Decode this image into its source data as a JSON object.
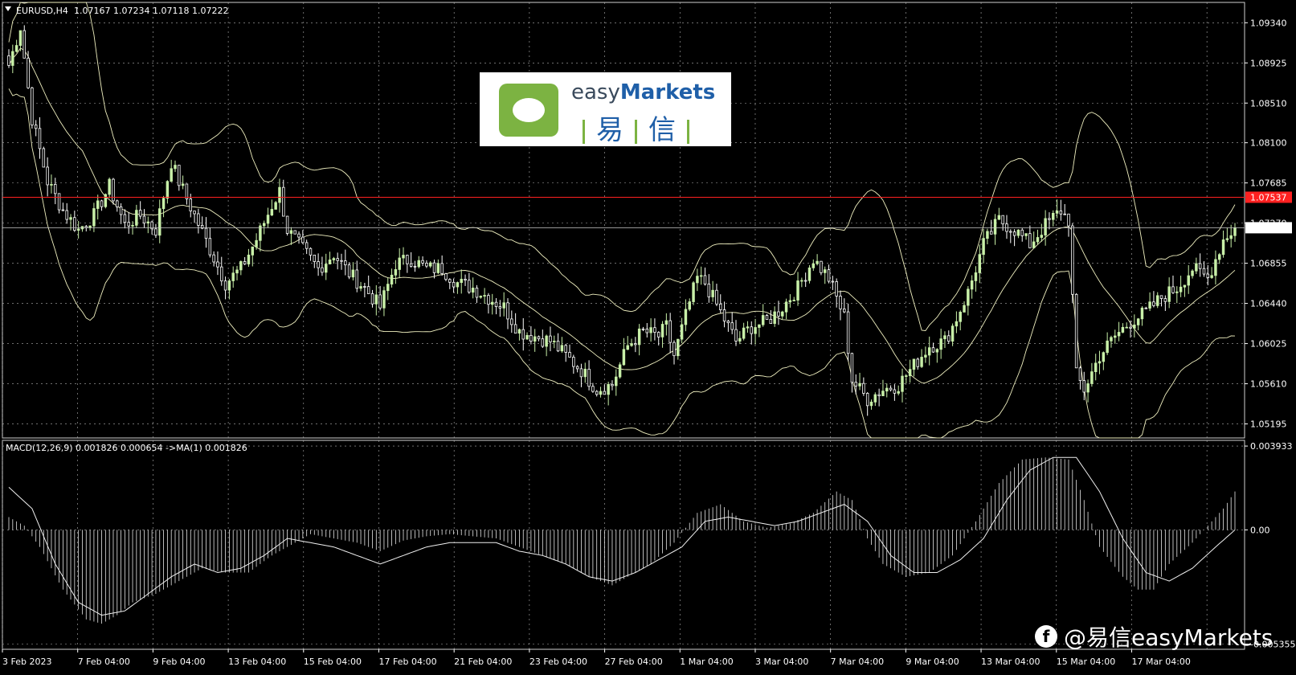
{
  "chart_data": [
    {
      "type": "candlestick",
      "symbol_label": "EURUSD,H4",
      "ohlc_label": "1.07167 1.07234 1.07118 1.07222",
      "y_ticks": [
        "1.09340",
        "1.08925",
        "1.08510",
        "1.08100",
        "1.07685",
        "1.07270",
        "1.06855",
        "1.06440",
        "1.06025",
        "1.05610",
        "1.05195"
      ],
      "y_tick_values": [
        1.0934,
        1.08925,
        1.0851,
        1.081,
        1.07685,
        1.0727,
        1.06855,
        1.0644,
        1.06025,
        1.0561,
        1.05195
      ],
      "ylim": [
        1.0505,
        1.0955
      ],
      "price_line": {
        "value": 1.07537,
        "label": "1.07537",
        "color": "#ff2020"
      },
      "current_price": {
        "value": 1.07222,
        "label": "1.07222"
      },
      "x_ticks": [
        "3 Feb 2023",
        "7 Feb 04:00",
        "9 Feb 04:00",
        "13 Feb 04:00",
        "15 Feb 04:00",
        "17 Feb 04:00",
        "21 Feb 04:00",
        "23 Feb 04:00",
        "27 Feb 04:00",
        "1 Mar 04:00",
        "3 Mar 04:00",
        "7 Mar 04:00",
        "9 Mar 04:00",
        "13 Mar 04:00",
        "15 Mar 04:00",
        "17 Mar 04:00"
      ],
      "close_path": [
        [
          0,
          1.089
        ],
        [
          3,
          1.093
        ],
        [
          6,
          1.0835
        ],
        [
          10,
          1.077
        ],
        [
          14,
          1.074
        ],
        [
          18,
          1.072
        ],
        [
          22,
          1.0735
        ],
        [
          26,
          1.0765
        ],
        [
          30,
          1.0725
        ],
        [
          34,
          1.0735
        ],
        [
          38,
          1.072
        ],
        [
          42,
          1.079
        ],
        [
          44,
          1.077
        ],
        [
          48,
          1.0735
        ],
        [
          52,
          1.07
        ],
        [
          56,
          1.0665
        ],
        [
          60,
          1.068
        ],
        [
          64,
          1.071
        ],
        [
          68,
          1.0745
        ],
        [
          70,
          1.076
        ],
        [
          72,
          1.072
        ],
        [
          76,
          1.07
        ],
        [
          80,
          1.068
        ],
        [
          84,
          1.0695
        ],
        [
          88,
          1.0675
        ],
        [
          92,
          1.066
        ],
        [
          96,
          1.064
        ],
        [
          100,
          1.0685
        ],
        [
          104,
          1.069
        ],
        [
          108,
          1.068
        ],
        [
          112,
          1.068
        ],
        [
          116,
          1.0665
        ],
        [
          120,
          1.066
        ],
        [
          124,
          1.065
        ],
        [
          128,
          1.064
        ],
        [
          132,
          1.0615
        ],
        [
          136,
          1.061
        ],
        [
          140,
          1.0605
        ],
        [
          144,
          1.059
        ],
        [
          148,
          1.0575
        ],
        [
          152,
          1.0555
        ],
        [
          156,
          1.056
        ],
        [
          160,
          1.06
        ],
        [
          164,
          1.0615
        ],
        [
          168,
          1.061
        ],
        [
          170,
          1.062
        ],
        [
          172,
          1.059
        ],
        [
          176,
          1.0645
        ],
        [
          178,
          1.067
        ],
        [
          180,
          1.0665
        ],
        [
          184,
          1.0635
        ],
        [
          188,
          1.0605
        ],
        [
          192,
          1.062
        ],
        [
          196,
          1.0625
        ],
        [
          200,
          1.064
        ],
        [
          204,
          1.066
        ],
        [
          208,
          1.069
        ],
        [
          212,
          1.067
        ],
        [
          216,
          1.063
        ],
        [
          218,
          1.0565
        ],
        [
          222,
          1.0545
        ],
        [
          226,
          1.0555
        ],
        [
          230,
          1.056
        ],
        [
          234,
          1.058
        ],
        [
          238,
          1.06
        ],
        [
          242,
          1.0605
        ],
        [
          244,
          1.062
        ],
        [
          248,
          1.0655
        ],
        [
          252,
          1.0705
        ],
        [
          256,
          1.073
        ],
        [
          260,
          1.072
        ],
        [
          264,
          1.0705
        ],
        [
          268,
          1.0725
        ],
        [
          272,
          1.074
        ],
        [
          274,
          1.073
        ],
        [
          276,
          1.057
        ],
        [
          278,
          1.0555
        ],
        [
          282,
          1.059
        ],
        [
          286,
          1.061
        ],
        [
          290,
          1.0625
        ],
        [
          294,
          1.0635
        ],
        [
          298,
          1.065
        ],
        [
          302,
          1.066
        ],
        [
          306,
          1.068
        ],
        [
          310,
          1.067
        ],
        [
          312,
          1.069
        ],
        [
          314,
          1.071
        ],
        [
          317,
          1.07222
        ]
      ],
      "n_bars": 318
    },
    {
      "type": "macd",
      "label": "MACD(12,26,9) 0.001826 0.000654  ->MA(1) 0.001826",
      "y_ticks": [
        "0.003933",
        "0.00",
        "-0.005355"
      ],
      "y_tick_values": [
        0.003933,
        0.0,
        -0.005355
      ],
      "ylim": [
        -0.0056,
        0.0042
      ],
      "histogram_path": [
        [
          0,
          0.0006
        ],
        [
          4,
          0.0002
        ],
        [
          8,
          -0.0008
        ],
        [
          14,
          -0.0028
        ],
        [
          20,
          -0.0042
        ],
        [
          24,
          -0.0044
        ],
        [
          28,
          -0.004
        ],
        [
          32,
          -0.0034
        ],
        [
          38,
          -0.003
        ],
        [
          44,
          -0.0024
        ],
        [
          50,
          -0.0018
        ],
        [
          56,
          -0.002
        ],
        [
          62,
          -0.002
        ],
        [
          68,
          -0.0012
        ],
        [
          74,
          -0.0006
        ],
        [
          78,
          -0.0002
        ],
        [
          84,
          -0.0004
        ],
        [
          90,
          -0.0006
        ],
        [
          96,
          -0.001
        ],
        [
          102,
          -0.0005
        ],
        [
          108,
          -0.0003
        ],
        [
          114,
          -0.0002
        ],
        [
          120,
          -0.0003
        ],
        [
          126,
          -0.0004
        ],
        [
          132,
          -0.0008
        ],
        [
          138,
          -0.0012
        ],
        [
          144,
          -0.0016
        ],
        [
          150,
          -0.0022
        ],
        [
          156,
          -0.0026
        ],
        [
          160,
          -0.0022
        ],
        [
          166,
          -0.0016
        ],
        [
          172,
          -0.0006
        ],
        [
          178,
          0.0008
        ],
        [
          184,
          0.0012
        ],
        [
          190,
          0.0004
        ],
        [
          196,
          0.0001
        ],
        [
          202,
          0.0003
        ],
        [
          208,
          0.0008
        ],
        [
          214,
          0.0018
        ],
        [
          218,
          0.0014
        ],
        [
          222,
          -0.0004
        ],
        [
          226,
          -0.0016
        ],
        [
          232,
          -0.0022
        ],
        [
          238,
          -0.002
        ],
        [
          244,
          -0.0012
        ],
        [
          250,
          0.0004
        ],
        [
          256,
          0.0022
        ],
        [
          262,
          0.0033
        ],
        [
          268,
          0.0034
        ],
        [
          274,
          0.0033
        ],
        [
          278,
          0.0014
        ],
        [
          282,
          -0.0008
        ],
        [
          288,
          -0.0022
        ],
        [
          292,
          -0.0028
        ],
        [
          296,
          -0.0028
        ],
        [
          300,
          -0.0016
        ],
        [
          306,
          -0.0006
        ],
        [
          310,
          0.0002
        ],
        [
          314,
          0.001
        ],
        [
          317,
          0.0018
        ]
      ],
      "signal_path": [
        [
          0,
          0.002
        ],
        [
          6,
          0.001
        ],
        [
          12,
          -0.0016
        ],
        [
          18,
          -0.0034
        ],
        [
          24,
          -0.004
        ],
        [
          30,
          -0.0038
        ],
        [
          36,
          -0.003
        ],
        [
          42,
          -0.0022
        ],
        [
          48,
          -0.0016
        ],
        [
          54,
          -0.002
        ],
        [
          60,
          -0.0018
        ],
        [
          66,
          -0.0012
        ],
        [
          72,
          -0.0004
        ],
        [
          78,
          -0.0006
        ],
        [
          84,
          -0.0008
        ],
        [
          90,
          -0.0012
        ],
        [
          96,
          -0.0016
        ],
        [
          102,
          -0.0012
        ],
        [
          108,
          -0.0008
        ],
        [
          114,
          -0.0006
        ],
        [
          120,
          -0.0006
        ],
        [
          126,
          -0.0006
        ],
        [
          132,
          -0.001
        ],
        [
          138,
          -0.0012
        ],
        [
          144,
          -0.0016
        ],
        [
          150,
          -0.0022
        ],
        [
          156,
          -0.0024
        ],
        [
          162,
          -0.002
        ],
        [
          168,
          -0.0014
        ],
        [
          174,
          -0.0008
        ],
        [
          180,
          0.0004
        ],
        [
          186,
          0.0006
        ],
        [
          192,
          0.0004
        ],
        [
          198,
          0.0002
        ],
        [
          204,
          0.0004
        ],
        [
          210,
          0.0008
        ],
        [
          216,
          0.0012
        ],
        [
          222,
          0.0004
        ],
        [
          228,
          -0.0012
        ],
        [
          234,
          -0.002
        ],
        [
          240,
          -0.002
        ],
        [
          246,
          -0.0014
        ],
        [
          252,
          -0.0004
        ],
        [
          258,
          0.0014
        ],
        [
          264,
          0.0028
        ],
        [
          270,
          0.0034
        ],
        [
          276,
          0.0034
        ],
        [
          282,
          0.0018
        ],
        [
          288,
          -0.0004
        ],
        [
          294,
          -0.002
        ],
        [
          300,
          -0.0024
        ],
        [
          306,
          -0.0018
        ],
        [
          312,
          -0.0008
        ],
        [
          317,
          0.0
        ]
      ]
    }
  ],
  "branding": {
    "logo_word_light": "easy",
    "logo_word_bold": "Markets",
    "logo_cn_1": "易",
    "logo_cn_2": "信",
    "watermark": "@易信easyMarkets",
    "watermark_icon": "f",
    "brand_green": "#7cb342",
    "brand_blue": "#1f5fa8"
  },
  "colors": {
    "background": "#000000",
    "bull_candle": "#c8f0a8",
    "bear_candle": "#ffffff",
    "grid": "#b0b0b0",
    "price_line": "#ff2020",
    "bands": "#f0f0c0"
  }
}
